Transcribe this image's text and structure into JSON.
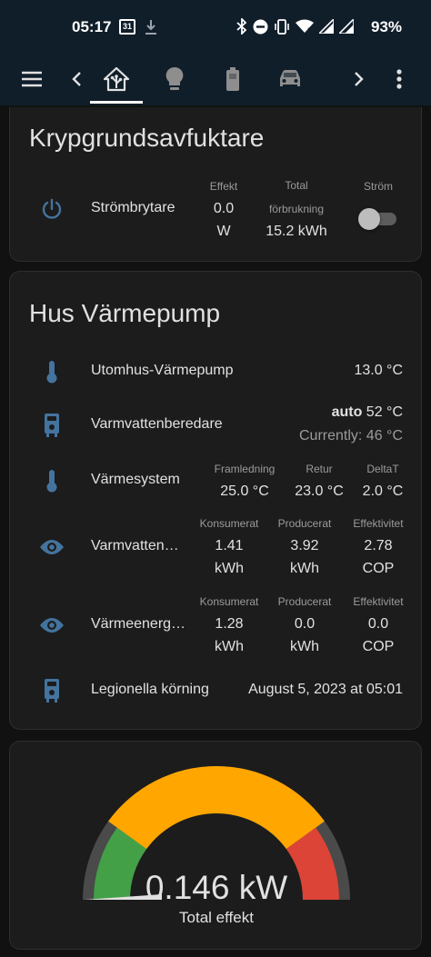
{
  "status_bar": {
    "time": "05:17",
    "calendar_day": "31",
    "battery": "93%"
  },
  "toolbar": {
    "icons": [
      "menu-icon",
      "chevron-left-icon",
      "home-assistant-icon",
      "lightbulb-icon",
      "battery-icon",
      "car-icon",
      "chevron-right-icon",
      "more-vert-icon"
    ]
  },
  "cards": {
    "kryp": {
      "title": "Krypgrundsavfuktare",
      "row": {
        "name": "Strömbrytare",
        "effekt_label": "Effekt",
        "effekt_value": "0.0",
        "effekt_unit": "W",
        "total_label_1": "Total",
        "total_label_2": "förbrukning",
        "total_value": "15.2 kWh",
        "strom_label": "Ström"
      }
    },
    "hus": {
      "title": "Hus Värmepump",
      "rows": {
        "utomhus": {
          "name": "Utomhus-Värmepump",
          "value": "13.0 °C"
        },
        "varmvattenberedare": {
          "name": "Varmvattenberedare",
          "mode": "auto",
          "target": "52 °C",
          "current": "Currently: 46 °C"
        },
        "varmesystem": {
          "name": "Värmesystem",
          "labels": [
            "Framledning",
            "Retur",
            "DeltaT"
          ],
          "values": [
            "25.0 °C",
            "23.0 °C",
            "2.0 °C"
          ]
        },
        "varmvatten": {
          "name": "Varmvatten…",
          "labels": [
            "Konsumerat",
            "Producerat",
            "Effektivitet"
          ],
          "values": [
            "1.41",
            "3.92",
            "2.78"
          ],
          "units": [
            "kWh",
            "kWh",
            "COP"
          ]
        },
        "varmeenergi": {
          "name": "Värmeenerg…",
          "labels": [
            "Konsumerat",
            "Producerat",
            "Effektivitet"
          ],
          "values": [
            "1.28",
            "0.0",
            "0.0"
          ],
          "units": [
            "kWh",
            "kWh",
            "COP"
          ]
        },
        "legionella": {
          "name": "Legionella körning",
          "value": "August 5, 2023 at 05:01"
        }
      }
    },
    "gauge": {
      "value": "0.146 kW",
      "label": "Total effekt",
      "fraction": 0.01,
      "colors": {
        "green": "#43a047",
        "yellow": "#ffa600",
        "red": "#db4437",
        "track": "#4a4a4a"
      }
    }
  },
  "colors": {
    "accent_icon": "#44739e",
    "card_bg": "#1c1c1c",
    "header_bg": "#101e2a"
  }
}
